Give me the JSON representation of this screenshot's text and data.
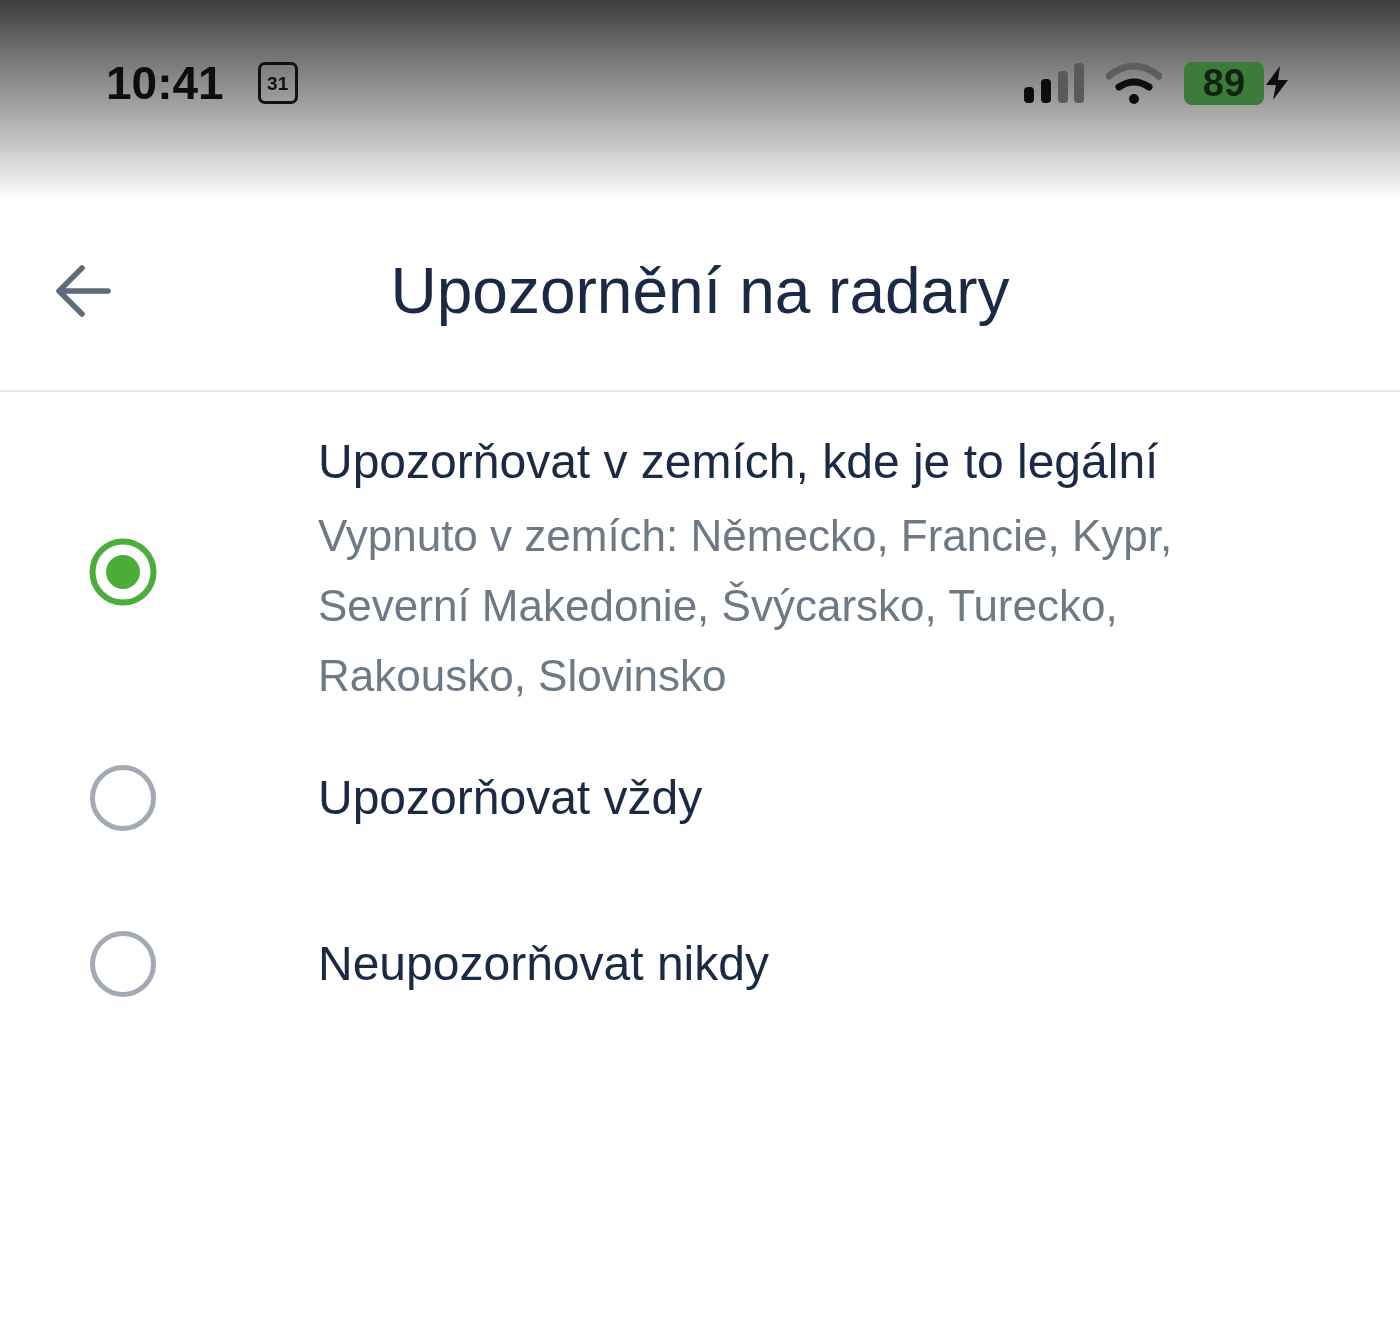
{
  "status_bar": {
    "time": "10:41",
    "calendar_day": "31",
    "battery": {
      "reading": "89",
      "charging": true
    }
  },
  "header": {
    "title": "Upozornění na radary"
  },
  "options": [
    {
      "title": "Upozorňovat v zemích, kde je to legální",
      "subtitle": "Vypnuto v zemích: Německo, Francie, Kypr, Severní Makedonie, Švýcarsko, Turecko, Rakousko, Slovinsko",
      "selected": true
    },
    {
      "title": "Upozorňovat vždy",
      "selected": false
    },
    {
      "title": "Neupozorňovat nikdy",
      "selected": false
    }
  ]
}
